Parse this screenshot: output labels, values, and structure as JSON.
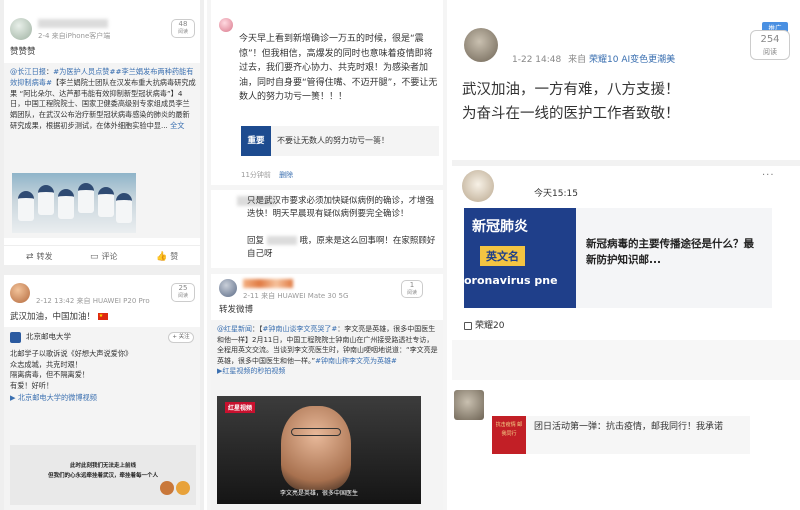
{
  "col1": {
    "post1": {
      "views": "48",
      "views_label": "阅读",
      "time": "2-4",
      "source": "来自iPhone客户端",
      "text": "赞赞赞",
      "repost_author": "@长江日报",
      "repost_tag1": "#为医护人员点赞#",
      "repost_tag2": "#李兰娟发布两种药能有效抑制病毒#",
      "repost_body": "【李兰娟院士团队在汉发布重大抗病毒研究成果 “阿比朵尔、达芦那韦能有效抑制新型冠状病毒”】4日，中国工程院院士、国家卫健委高级别专家组成员李兰娟团队，在武汉公布治疗新型冠状病毒感染的肺炎的最新研究成果，根据初步测试，在体外细胞实验中显...",
      "full_text": "全文",
      "actions": [
        "转发",
        "评论",
        "赞"
      ]
    },
    "post2": {
      "time": "2-12 13:42",
      "source": "来自 HUAWEI P20 Pro",
      "views": "25",
      "views_label": "阅读",
      "text": "武汉加油，中国加油！",
      "flag_icon": "china-flag",
      "repost_author": "北京邮电大学",
      "follow_label": "+ 关注",
      "repost_body": "北邮学子以歌诉说《好想大声说爱你》\n众志成城，共克时艰！\n隔离病毒，但不隔离爱！\n有爱！好听！",
      "video_link": "北京邮电大学的微博视频",
      "video_caption_1": "此时此刻我们无法走上前线",
      "video_caption_2": "但我们的心永远牵挂着武汉，牵挂着每一个人"
    }
  },
  "col2": {
    "post1": {
      "text": "今天早上看到新增确诊一万五的时候，很是“震惊”！但我相信，高爆发的同时也意味着疫情即将过去，我们要齐心协力、共克时艰！为感染者加油，同时自身要“管得住嘴、不迈开腿”，不要让无数人的努力功亏一篑！！！",
      "article_badge": "重要",
      "article_title": "不要让无数人的努力功亏一篑！",
      "time": "11分钟前",
      "delete_label": "删除"
    },
    "post2": {
      "text": "只是武汉市要求必须加快疑似病例的确诊，才增强迭快！明天早晨现有疑似病例要完全确诊！",
      "reply_label": "回复",
      "reply_text": "哦，原来是这么回事啊！在家照顾好自己呀"
    },
    "post3": {
      "time": "2-11",
      "source": "来自 HUAWEI Mate 30 5G",
      "views": "1",
      "views_label": "阅读",
      "text": "转发微博",
      "repost_author": "@红星新闻",
      "repost_tag1": "#钟南山谈李文亮哭了#",
      "repost_body": "：李文亮是英雄，很多中国医生和他一样】2月11日，中国工程院院士钟南山在广州接受路透社专访，全程用英文交流。当谈到李文亮医生时，钟南山哽咽地说道：“李文亮是英雄，很多中国医生和他一样。”",
      "repost_tag2": "#钟南山称李文亮为英雄#",
      "video_link": "红星视频的秒拍视频",
      "video_logo": "红星视频",
      "video_subtitle": "李文亮是英雄，很多中国医生"
    }
  },
  "col3": {
    "post1": {
      "time": "1-22 14:48",
      "source_prefix": "来自",
      "source": "荣耀10 AI变色更潮美",
      "views": "254",
      "views_label": "阅读",
      "promote_label": "推广",
      "text_line1": "武汉加油，一方有难，八方支援！",
      "text_line2": "为奋斗在一线的医护工作者致敬！"
    },
    "post2": {
      "time": "今天15:15",
      "more_icon": "more-dots",
      "banner_title": "新冠肺炎",
      "banner_sub": "英文名",
      "banner_en": "oronavirus pne",
      "article_title": "新冠病毒的主要传播途径是什么？最新防护知识邮...",
      "device": "荣耀20"
    },
    "post3": {
      "text": "团日活动第一弹：抗击疫情，邮我同行！我承诺",
      "thumb_text": "抗击疫情 邮我同行"
    }
  }
}
